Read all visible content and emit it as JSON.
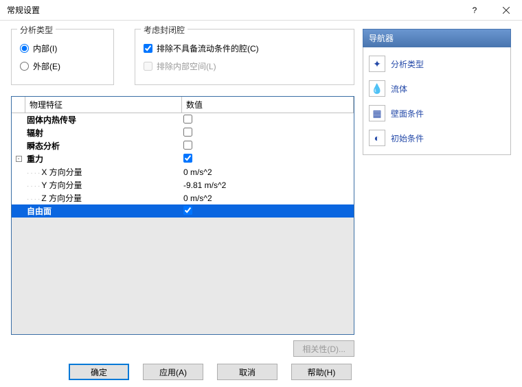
{
  "window": {
    "title": "常规设置"
  },
  "analysis": {
    "legend": "分析类型",
    "internal": "内部(I)",
    "external": "外部(E)",
    "selected": "internal"
  },
  "cavity": {
    "legend": "考虑封闭腔",
    "excludeNoFlow": "排除不具备流动条件的腔(C)",
    "excludeInternal": "排除内部空间(L)"
  },
  "grid": {
    "headers": {
      "property": "物理特征",
      "value": "数值"
    },
    "rows": [
      {
        "label": "固体内热传导",
        "type": "check",
        "checked": false,
        "indent": 1
      },
      {
        "label": "辐射",
        "type": "check",
        "checked": false,
        "indent": 1
      },
      {
        "label": "瞬态分析",
        "type": "check",
        "checked": false,
        "indent": 1
      },
      {
        "label": "重力",
        "type": "check",
        "checked": true,
        "indent": 0,
        "expander": true
      },
      {
        "label": "X 方向分量",
        "type": "value",
        "value": "0 m/s^2",
        "indent": 2
      },
      {
        "label": "Y 方向分量",
        "type": "value",
        "value": "-9.81 m/s^2",
        "indent": 2
      },
      {
        "label": "Z 方向分量",
        "type": "value",
        "value": "0 m/s^2",
        "indent": 2
      },
      {
        "label": "自由面",
        "type": "check",
        "checked": true,
        "indent": 1,
        "selected": true
      }
    ]
  },
  "dep_button": "相关性(D)...",
  "nav": {
    "header": "导航器",
    "items": [
      {
        "label": "分析类型",
        "icon": "✦"
      },
      {
        "label": "流体",
        "icon": "💧"
      },
      {
        "label": "壁面条件",
        "icon": "▦"
      },
      {
        "label": "初始条件",
        "icon": "◐"
      }
    ]
  },
  "buttons": {
    "ok": "确定",
    "apply": "应用(A)",
    "cancel": "取消",
    "help": "帮助(H)"
  }
}
